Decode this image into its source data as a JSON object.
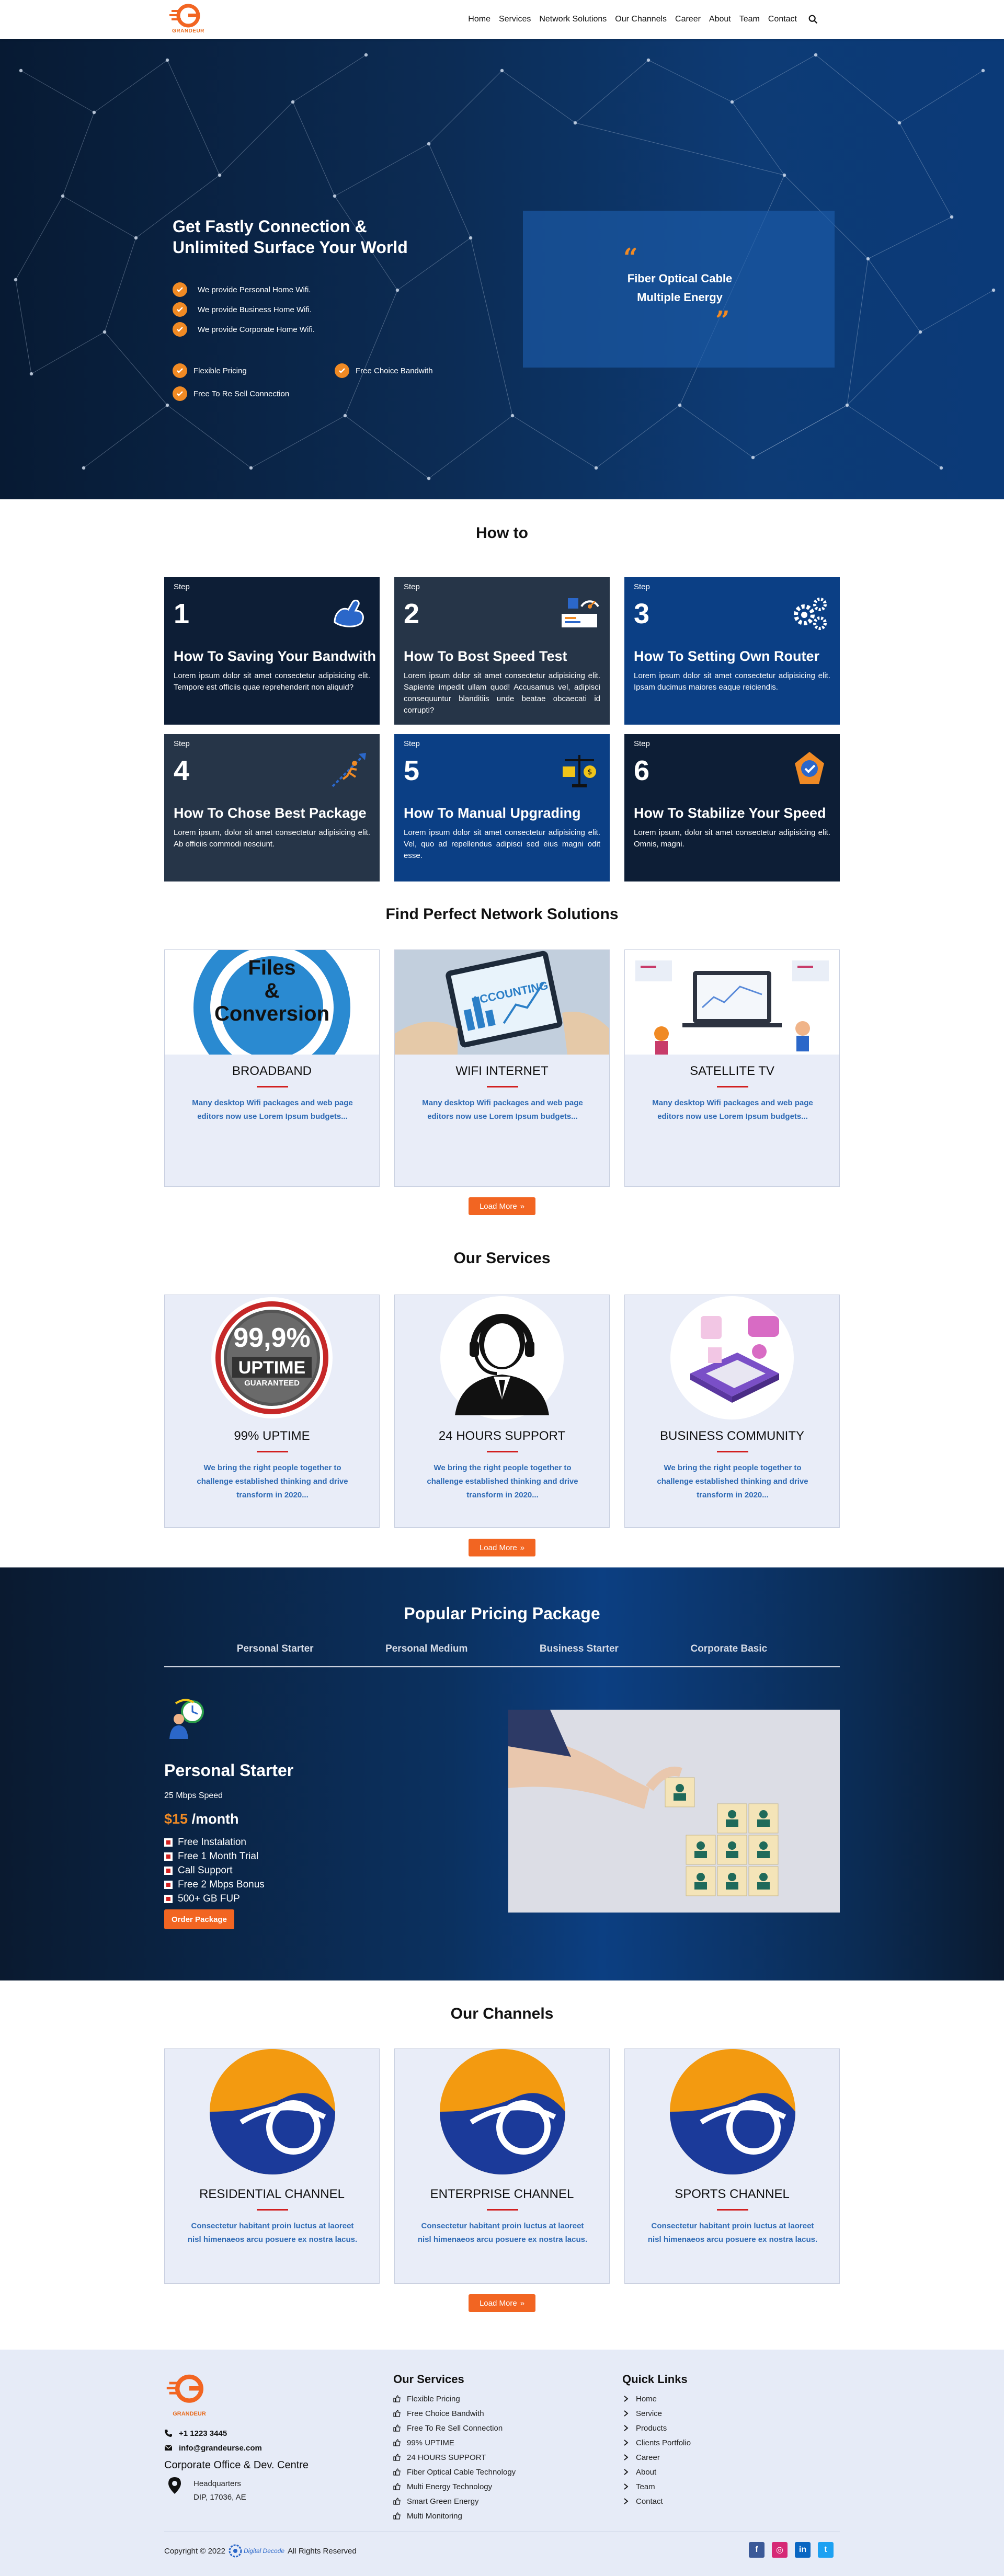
{
  "header": {
    "logo_text": "GRANDEUR",
    "nav": [
      "Home",
      "Services",
      "Network Solutions",
      "Our Channels",
      "Career",
      "About",
      "Team",
      "Contact"
    ]
  },
  "hero": {
    "title_line1": "Get Fastly Connection &",
    "title_line2": "Unlimited Surface Your World",
    "points": [
      "We provide Personal Home Wifi.",
      "We provide Business Home Wifi.",
      "We provide Corporate Home Wifi."
    ],
    "features_left": [
      "Flexible Pricing",
      "Free To Re Sell Connection"
    ],
    "features_right": [
      "Free Choice Bandwith"
    ],
    "quote_line1": "Fiber Optical Cable",
    "quote_line2": "Multiple Energy"
  },
  "howto": {
    "title": "How to",
    "cards": [
      {
        "step": "Step",
        "num": "1",
        "head": "How To Saving Your Bandwith",
        "body": "Lorem ipsum dolor sit amet consectetur adipisicing elit. Tempore est officiis quae reprehenderit non aliquid?",
        "icon": "muscle-arm-icon"
      },
      {
        "step": "Step",
        "num": "2",
        "head": "How To Bost Speed Test",
        "body": "Lorem ipsum dolor sit amet consectetur adipisicing elit. Sapiente impedit ullam quod! Accusamus vel, adipisci consequuntur blanditiis unde beatae obcaecati id corrupti?",
        "icon": "speed-dashboard-icon"
      },
      {
        "step": "Step",
        "num": "3",
        "head": "How To Setting Own Router",
        "body": "Lorem ipsum dolor sit amet consectetur adipisicing elit. Ipsam ducimus maiores eaque reiciendis.",
        "icon": "gears-icon"
      },
      {
        "step": "Step",
        "num": "4",
        "head": "How To Chose Best Package",
        "body": "Lorem ipsum, dolor sit amet consectetur adipisicing elit. Ab officiis commodi nesciunt.",
        "icon": "runner-arrow-icon"
      },
      {
        "step": "Step",
        "num": "5",
        "head": "How To Manual Upgrading",
        "body": "Lorem ipsum dolor sit amet consectetur adipisicing elit. Vel, quo ad repellendus adipisci sed eius magni odit esse.",
        "icon": "balance-scale-icon"
      },
      {
        "step": "Step",
        "num": "6",
        "head": "How To Stabilize Your Speed",
        "body": "Lorem ipsum, dolor sit amet consectetur adipisicing elit. Omnis, magni.",
        "icon": "shield-badge-icon"
      }
    ]
  },
  "solutions": {
    "title": "Find Perfect Network Solutions",
    "cards": [
      {
        "name": "BROADBAND",
        "desc": "Many desktop Wifi packages and web page editors now use Lorem Ipsum budgets...",
        "img_text1": "Files",
        "img_text2": "&",
        "img_text3": "Conversion"
      },
      {
        "name": "WIFI INTERNET",
        "desc": "Many desktop Wifi packages and web page editors now use Lorem Ipsum budgets...",
        "img_text1": "ACCOUNTING"
      },
      {
        "name": "SATELLITE TV",
        "desc": "Many desktop Wifi packages and web page editors now use Lorem Ipsum budgets..."
      }
    ],
    "load_more": "Load More"
  },
  "services": {
    "title": "Our Services",
    "cards": [
      {
        "name": "99% UPTIME",
        "desc": "We bring the right people together to challenge established thinking and drive transform in 2020...",
        "badge1": "99,9%",
        "badge2": "UPTIME",
        "badge3": "GUARANTEED"
      },
      {
        "name": "24 HOURS SUPPORT",
        "desc": "We bring the right people together to challenge established thinking and drive transform in 2020..."
      },
      {
        "name": "BUSINESS COMMUNITY",
        "desc": "We bring the right people together to challenge established thinking and drive transform in 2020..."
      }
    ],
    "load_more": "Load More"
  },
  "pricing": {
    "title": "Popular Pricing Package",
    "tabs": [
      "Personal Starter",
      "Personal Medium",
      "Business Starter",
      "Corporate Basic"
    ],
    "package": {
      "name": "Personal Starter",
      "speed": "25 Mbps Speed",
      "price": "$15",
      "period": " /month",
      "features": [
        "Free Instalation",
        "Free 1 Month Trial",
        "Call Support",
        "Free 2 Mbps Bonus",
        "500+ GB FUP"
      ],
      "order": "Order Package"
    }
  },
  "channels": {
    "title": "Our Channels",
    "cards": [
      {
        "name": "RESIDENTIAL CHANNEL",
        "desc": "Consectetur habitant proin luctus at laoreet nisl himenaeos arcu posuere ex nostra lacus."
      },
      {
        "name": "ENTERPRISE CHANNEL",
        "desc": "Consectetur habitant proin luctus at laoreet nisl himenaeos arcu posuere ex nostra lacus."
      },
      {
        "name": "SPORTS CHANNEL",
        "desc": "Consectetur habitant proin luctus at laoreet nisl himenaeos arcu posuere ex nostra lacus."
      }
    ],
    "load_more": "Load More"
  },
  "footer": {
    "logo_text": "GRANDEUR",
    "phone": "+1 1223 3445",
    "email": "info@grandeurse.com",
    "office_title": "Corporate Office & Dev. Centre",
    "address": [
      "Headquarters",
      "DIP, 17036, AE"
    ],
    "services_title": "Our Services",
    "services": [
      "Flexible Pricing",
      "Free Choice Bandwith",
      "Free To Re Sell Connection",
      "99% UPTIME",
      "24 HOURS SUPPORT",
      "Fiber Optical Cable Technology",
      "Multi Energy Technology",
      "Smart Green Energy",
      "Multi Monitoring"
    ],
    "links_title": "Quick Links",
    "links": [
      "Home",
      "Service",
      "Products",
      "Clients Portfolio",
      "Career",
      "About",
      "Team",
      "Contact"
    ],
    "copyright": "Copyright © 2022",
    "maker": "Digital Decode",
    "rights": "All Rights Reserved"
  },
  "colors": {
    "accent": "#f26522",
    "brand_blue": "#0b3f85",
    "card_bg": "#e9edf8"
  }
}
